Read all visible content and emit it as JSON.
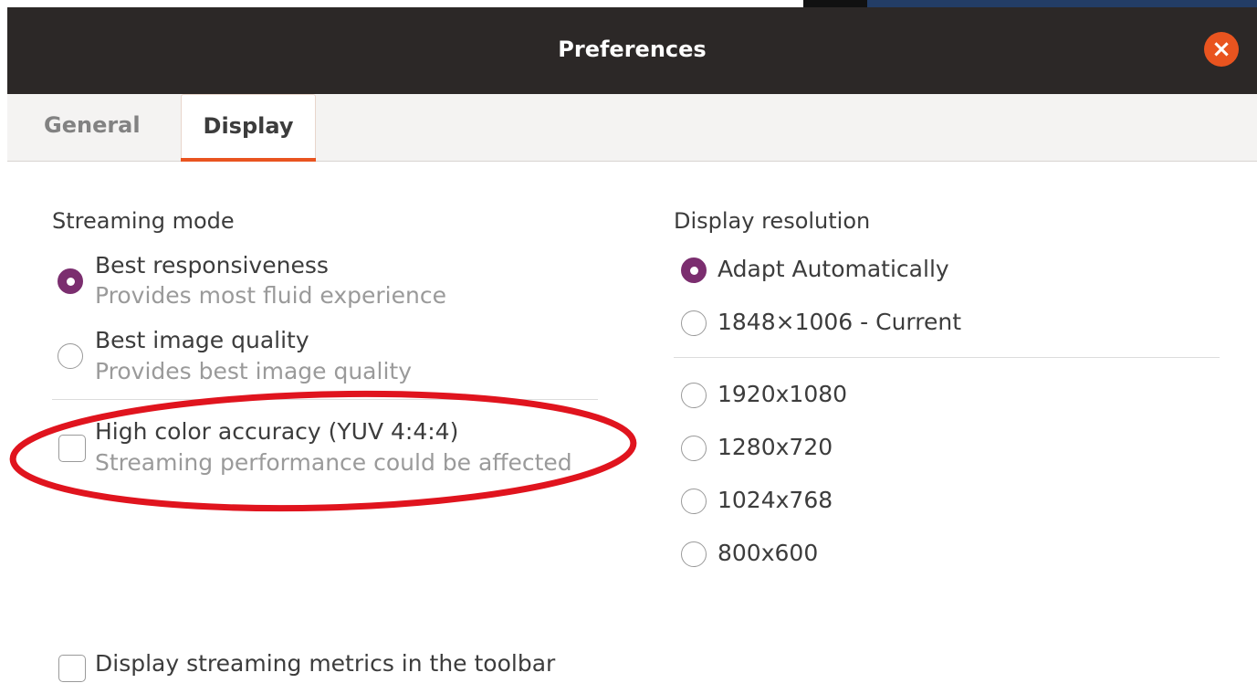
{
  "window": {
    "title": "Preferences",
    "close_icon": "×"
  },
  "tabs": [
    {
      "label": "General",
      "selected": false
    },
    {
      "label": "Display",
      "selected": true
    }
  ],
  "streaming_mode": {
    "title": "Streaming mode",
    "options": [
      {
        "label": "Best responsiveness",
        "description": "Provides most fluid experience",
        "checked": true
      },
      {
        "label": "Best image quality",
        "description": "Provides best image quality",
        "checked": false
      }
    ],
    "high_color": {
      "label": "High color accuracy (YUV 4:4:4)",
      "description": "Streaming performance could be affected",
      "checked": false
    }
  },
  "display_resolution": {
    "title": "Display resolution",
    "options": [
      {
        "label": "Adapt Automatically",
        "checked": true
      },
      {
        "label": "1848×1006 - Current",
        "checked": false
      },
      {
        "label": "1920x1080",
        "checked": false
      },
      {
        "label": "1280x720",
        "checked": false
      },
      {
        "label": "1024x768",
        "checked": false
      },
      {
        "label": "800x600",
        "checked": false
      }
    ]
  },
  "metrics": {
    "label": "Display streaming metrics in the toolbar",
    "checked": false
  },
  "colors": {
    "accent": "#e95420",
    "radio_checked": "#7b2e6f",
    "titlebar": "#2c2827",
    "annotation": "#e0141e"
  }
}
